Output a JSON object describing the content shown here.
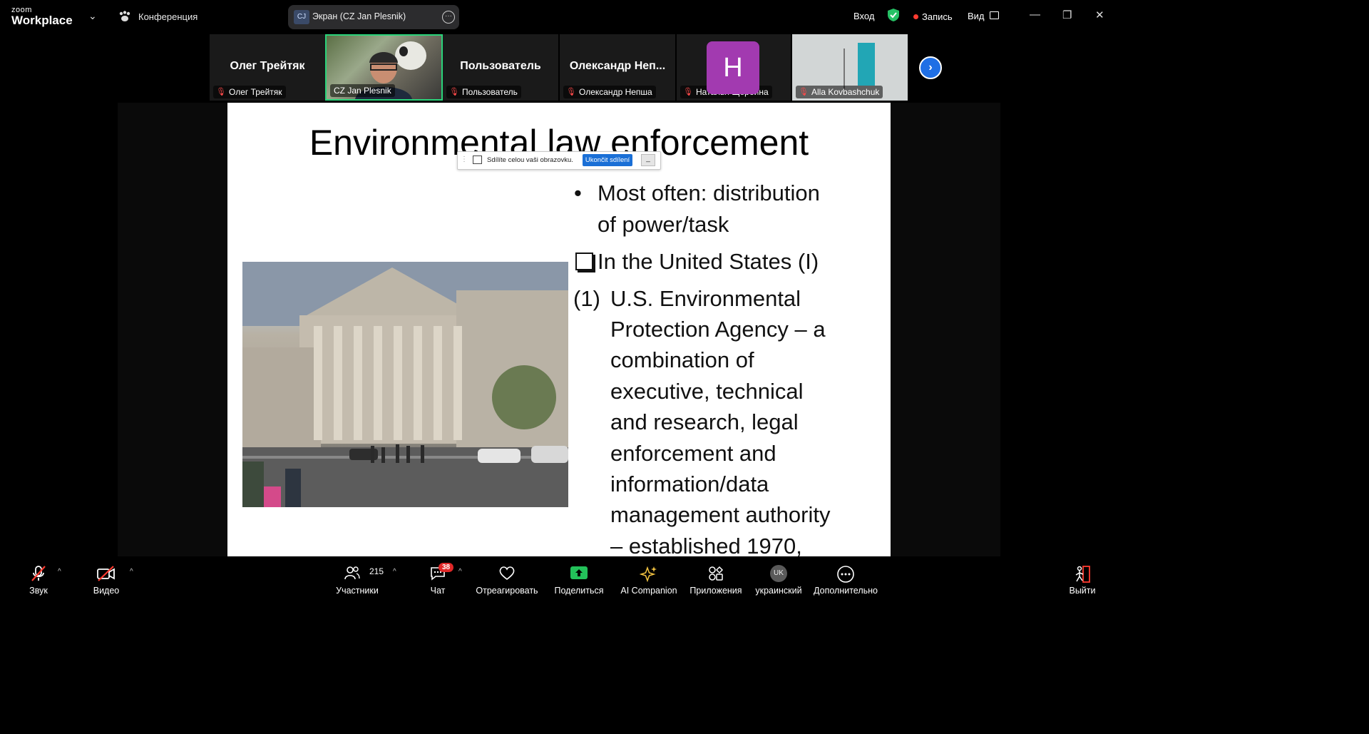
{
  "app": {
    "logo_small": "zoom",
    "logo_big": "Workplace"
  },
  "topbar": {
    "conference_label": "Конференция",
    "share_initials": "CJ",
    "share_title": "Экран (CZ Jan Plesnik)",
    "signin": "Вход",
    "record": "Запись",
    "view": "Вид"
  },
  "participants": [
    {
      "display": "Олег Трейтяк",
      "tag": "Олег Трейтяк",
      "muted": true
    },
    {
      "display": "",
      "tag": "CZ Jan Plesnik",
      "muted": true
    },
    {
      "display": "Пользователь",
      "tag": "Пользователь",
      "muted": true
    },
    {
      "display": "Олександр  Неп...",
      "tag": "Олександр Непша",
      "muted": true
    },
    {
      "display": "H",
      "tag": "Наталья Щербина",
      "muted": true
    },
    {
      "display": "",
      "tag": "Alla Kovbashchuk",
      "muted": true
    }
  ],
  "slide": {
    "title": "Environmental law enforcement",
    "sharebar": {
      "message": "Sdílíte celou vaši obrazovku.",
      "stop": "Ukončit sdílení"
    },
    "bullet_1": [
      "Most often: distribution",
      "of power/task"
    ],
    "checkbox_item": "In the United States (I)",
    "numbered_marker": "(1)",
    "numbered_lines": [
      "U.S. Environmental",
      "Protection Agency – a",
      "combination of",
      "executive, technical",
      "and research, legal",
      "enforcement and",
      "information/data",
      "management authority",
      "– established 1970,"
    ]
  },
  "toolbar": {
    "audio": "Звук",
    "video": "Видео",
    "participants": "Участники",
    "participants_count": "215",
    "chat": "Чат",
    "chat_badge": "38",
    "react": "Отреагировать",
    "share": "Поделиться",
    "ai": "AI Companion",
    "apps": "Приложения",
    "language": "украинский",
    "language_initials": "UK",
    "more": "Дополнительно",
    "leave": "Выйти"
  },
  "colors": {
    "accent": "#1f6fe5",
    "share_green": "#2ad37a",
    "mute_red": "#ff4a4a",
    "h_avatar": "#a23ab0"
  }
}
